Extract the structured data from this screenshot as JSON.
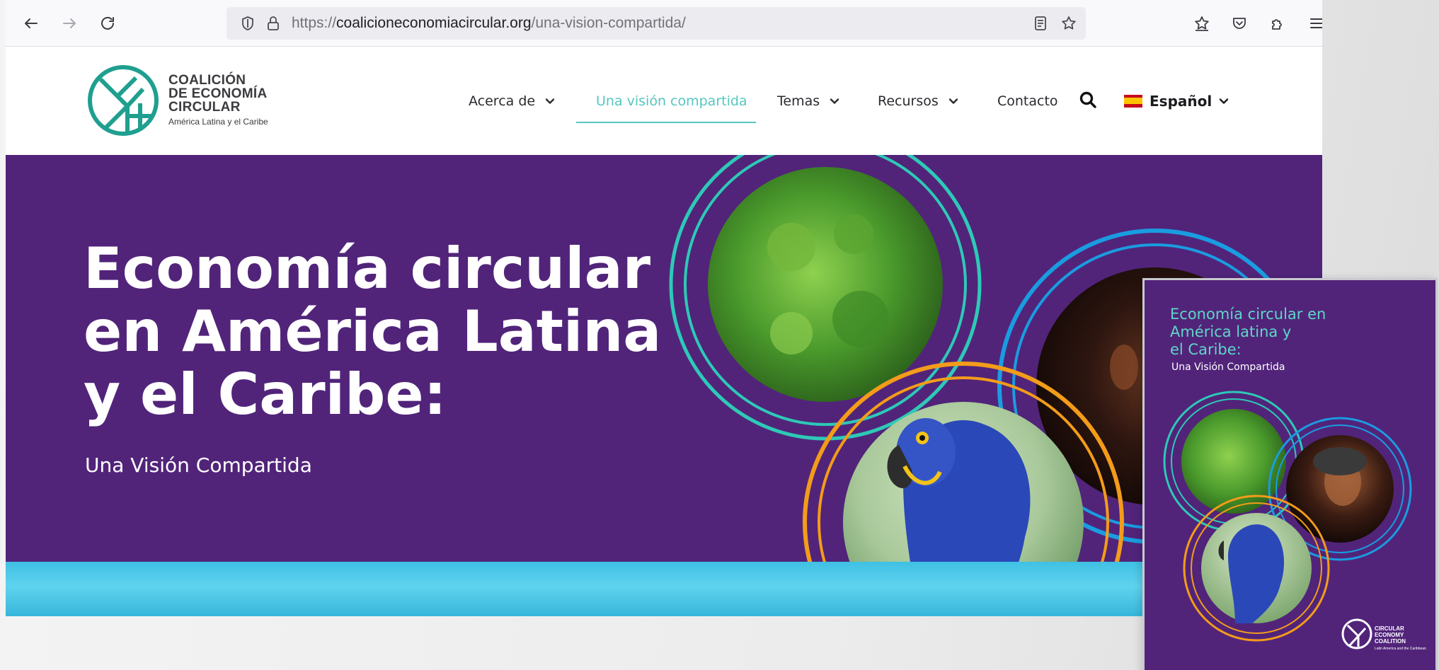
{
  "browser": {
    "url_scheme": "https://",
    "url_host": "coalicioneconomiacircular.org",
    "url_path": "/una-vision-compartida/"
  },
  "site": {
    "logo_lines": [
      "COALICIÓN",
      "DE ECONOMÍA",
      "CIRCULAR"
    ],
    "logo_sub": "América Latina y el Caribe",
    "brand_teal": "#1f9f8f",
    "nav": [
      {
        "label": "Acerca de",
        "dropdown": true,
        "active": false
      },
      {
        "label": "Una visión compartida",
        "dropdown": false,
        "active": true
      },
      {
        "label": "Temas",
        "dropdown": true,
        "active": false
      },
      {
        "label": "Recursos",
        "dropdown": true,
        "active": false
      },
      {
        "label": "Contacto",
        "dropdown": false,
        "active": false
      }
    ],
    "language": "Español",
    "accent_color": "#54c7c0"
  },
  "hero": {
    "title": "Economía circular\nen América Latina\ny el Caribe:",
    "subtitle": "Una Visión Compartida",
    "background": "#51247a",
    "images": [
      "forest-canopy-image",
      "woman-portrait-image",
      "blue-macaw-image"
    ]
  },
  "brochure": {
    "title": "Economía circular en\nAmérica latina y\nel Caribe:",
    "subtitle": "Una Visión Compartida",
    "logo_text": "CIRCULAR\nECONOMY\nCOALITION",
    "logo_sub": "Latin America and the Caribbean"
  }
}
